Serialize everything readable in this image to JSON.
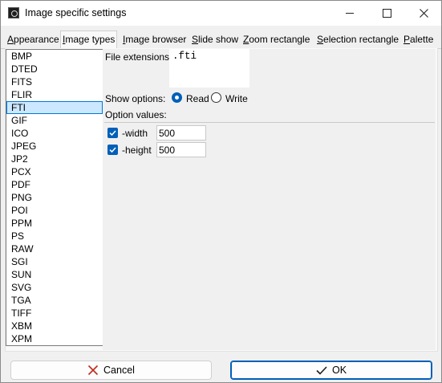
{
  "window": {
    "title": "Image specific settings",
    "controls": {
      "minimize": "minimize",
      "maximize": "maximize",
      "close": "✕"
    }
  },
  "tabs": [
    {
      "pre": "",
      "u": "A",
      "post": "ppearance"
    },
    {
      "pre": "",
      "u": "I",
      "post": "mage types"
    },
    {
      "pre": "",
      "u": "I",
      "post": "mage browser"
    },
    {
      "pre": "",
      "u": "S",
      "post": "lide show"
    },
    {
      "pre": "",
      "u": "Z",
      "post": "oom rectangle"
    },
    {
      "pre": "",
      "u": "S",
      "post": "election rectangle"
    },
    {
      "pre": "",
      "u": "P",
      "post": "alette"
    }
  ],
  "active_tab_index": 1,
  "image_types": [
    "BMP",
    "DTED",
    "FITS",
    "FLIR",
    "FTI",
    "GIF",
    "ICO",
    "JPEG",
    "JP2",
    "PCX",
    "PDF",
    "PNG",
    "POI",
    "PPM",
    "PS",
    "RAW",
    "SGI",
    "SUN",
    "SVG",
    "TGA",
    "TIFF",
    "XBM",
    "XPM"
  ],
  "selected_type": "FTI",
  "settings": {
    "file_extensions_label": "File extensions:",
    "file_extensions_value": ".fti",
    "show_options_label": "Show options:",
    "read_label": "Read",
    "write_label": "Write",
    "show_option_selected": "Read",
    "option_values_label": "Option values:",
    "options": [
      {
        "name": "-width",
        "value": "500",
        "checked": true
      },
      {
        "name": "-height",
        "value": "500",
        "checked": true
      }
    ]
  },
  "buttons": {
    "cancel_label": "Cancel",
    "ok_label": "OK"
  },
  "colors": {
    "accent": "#005fb8",
    "selection_bg": "#cce8ff",
    "selection_border": "#0078d7",
    "cancel_icon": "#c42b1c",
    "ok_icon": "#1e1e1e"
  }
}
